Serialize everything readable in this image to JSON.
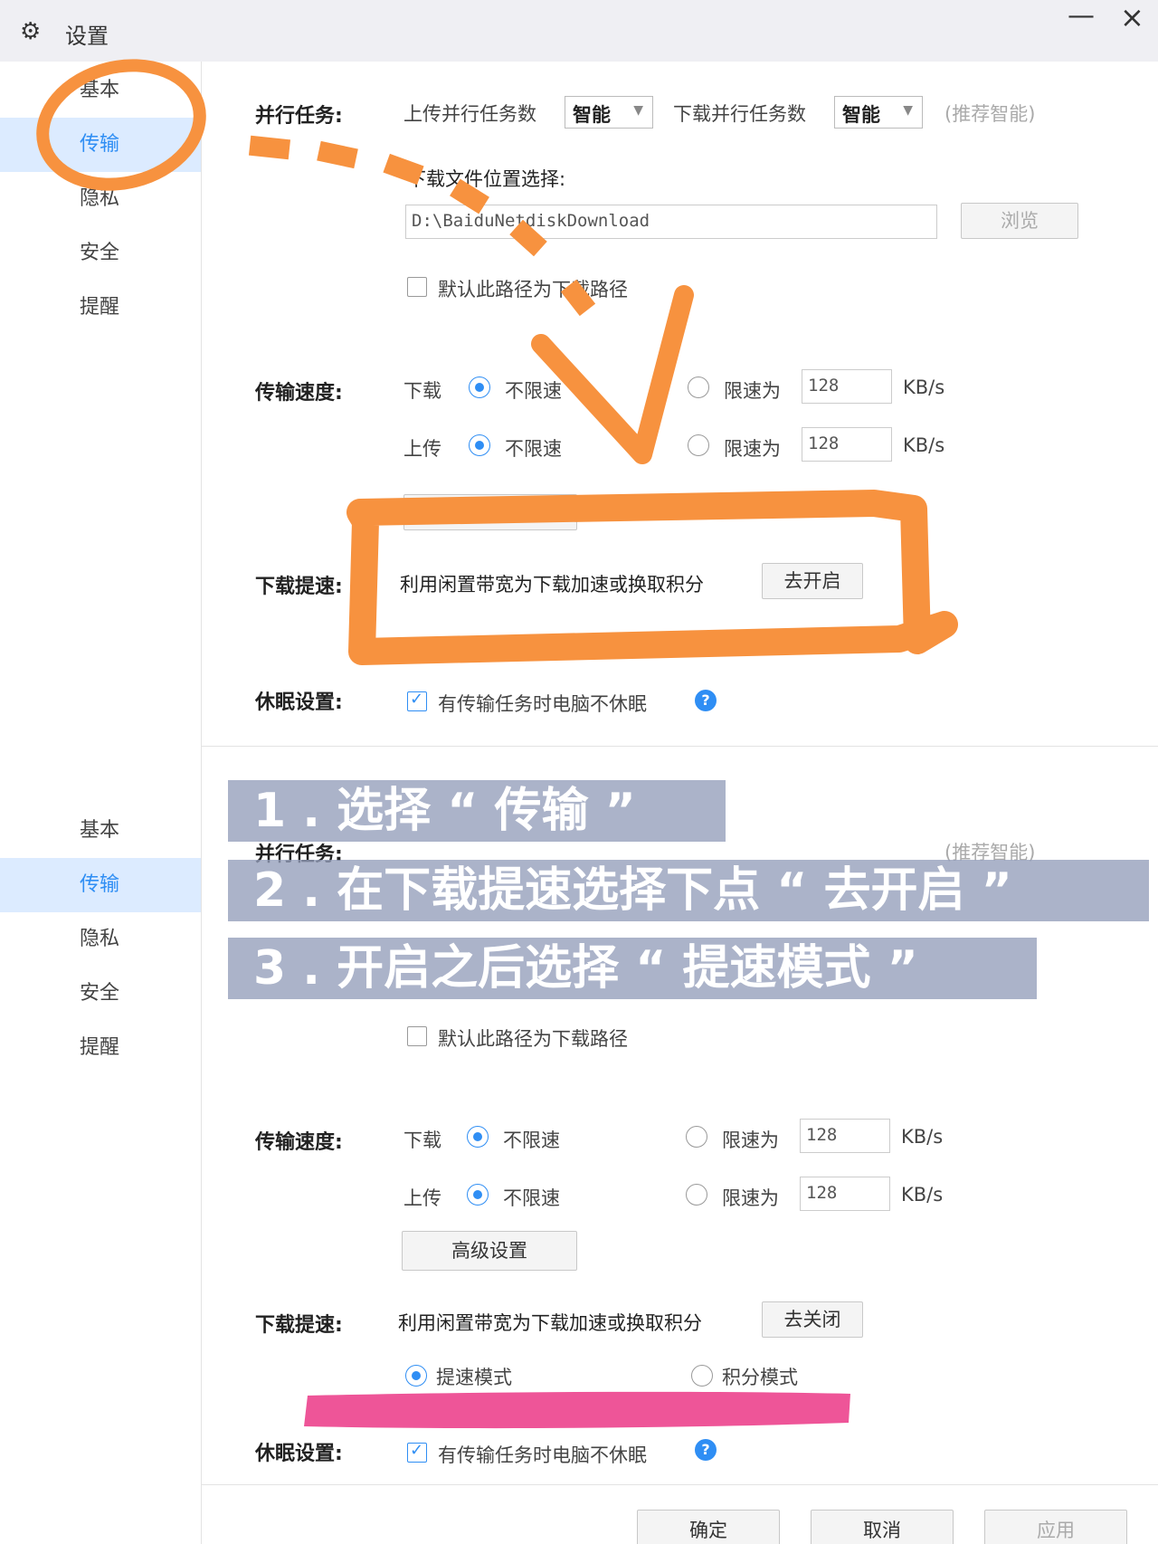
{
  "window": {
    "title": "设置",
    "minimize_symbol": "—",
    "close_symbol": "×"
  },
  "sidebar": {
    "items": [
      {
        "label": "基本"
      },
      {
        "label": "传输"
      },
      {
        "label": "隐私"
      },
      {
        "label": "安全"
      },
      {
        "label": "提醒"
      }
    ],
    "active": "传输"
  },
  "settings": {
    "parallel": {
      "label": "并行任务:",
      "upload_label": "上传并行任务数",
      "upload_value": "智能",
      "download_label": "下载并行任务数",
      "download_value": "智能",
      "hint": "(推荐智能)"
    },
    "location": {
      "label": "下载文件位置选择:",
      "path": "D:\\BaiduNetdiskDownload",
      "browse": "浏览",
      "default_checkbox": "默认此路径为下载路径"
    },
    "speed": {
      "label": "传输速度:",
      "download": "下载",
      "upload": "上传",
      "unlimited": "不限速",
      "limit_to": "限速为",
      "limit_value": "128",
      "unit": "KB/s"
    },
    "advanced": "高级设置",
    "accel": {
      "label": "下载提速:",
      "desc": "利用闲置带宽为下载加速或换取积分",
      "enable_button": "去开启",
      "disable_button": "去关闭",
      "mode_speed": "提速模式",
      "mode_points": "积分模式"
    },
    "sleep": {
      "label": "休眠设置:",
      "checkbox": "有传输任务时电脑不休眠",
      "help_symbol": "?"
    },
    "footer": {
      "ok": "确定",
      "cancel": "取消",
      "apply": "应用"
    }
  },
  "annotations": {
    "steps": [
      "1 . 选择 “ 传输 ”",
      "2 . 在下载提速选择下点 “ 去开启 ”",
      "3 . 开启之后选择 “ 提速模式 ”"
    ],
    "highlight_color": "#f7923f",
    "underline_color": "#ee5598"
  }
}
